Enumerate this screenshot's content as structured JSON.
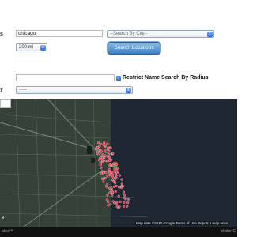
{
  "form": {
    "label_fragment_1": "s",
    "label_fragment_2": "y",
    "query_value": "chicago",
    "city_select": "--Search By City--",
    "radius_select": "200 mi",
    "search_button": "Search Locations",
    "name_input_value": "",
    "restrict_label": "Restrict Name Search By Radius",
    "restrict_checked": true,
    "type_select": "-----"
  },
  "map": {
    "footer": "Map data ©2010 Google   Terms of Use   Report a map error",
    "zoom_label": "",
    "small_label": "e"
  },
  "bottom_bar": {
    "left_text": "ates™",
    "right_text": "Visitor C"
  },
  "colors": {
    "land": "#344238",
    "water": "#1f2733",
    "marker": "#e0354a",
    "accent": "#3c7fc3"
  },
  "icons": {
    "dropdown": "chevron-updown-icon",
    "check": "checkmark-icon",
    "marker": "map-pin-icon"
  }
}
